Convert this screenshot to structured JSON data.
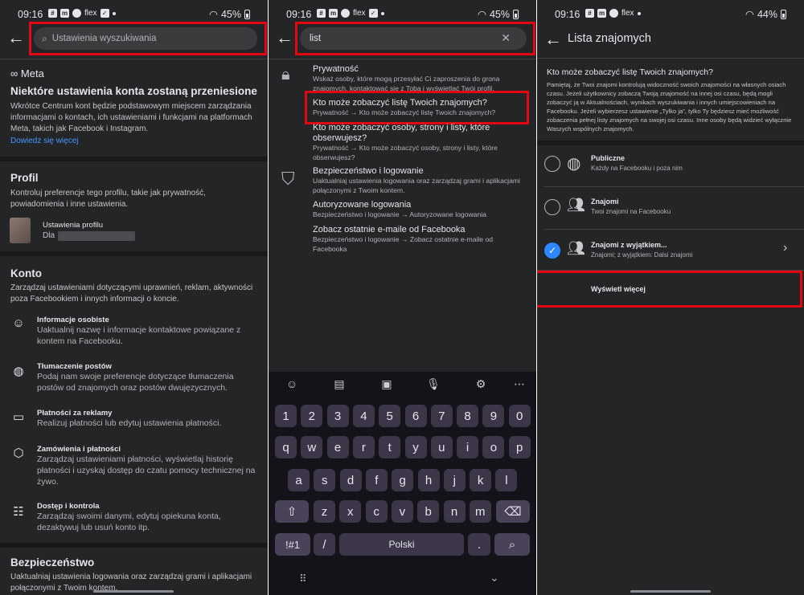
{
  "status": {
    "p1": {
      "time": "09:16",
      "battery": "45%",
      "icons_text": "flex"
    },
    "p2": {
      "time": "09:16",
      "battery": "45%",
      "icons_text": "flex"
    },
    "p3": {
      "time": "09:16",
      "battery": "44%",
      "icons_text": "flex"
    }
  },
  "panel1": {
    "search_placeholder": "Ustawienia wyszukiwania",
    "meta_logo": "Meta",
    "notice": {
      "title": "Niektóre ustawienia konta zostaną przeniesione",
      "body": "Wkrótce Centrum kont będzie podstawowym miejscem zarządzania informacjami o kontach, ich ustawieniami i funkcjami na platformach Meta, takich jak Facebook i Instagram.",
      "link": "Dowiedz się więcej"
    },
    "profile": {
      "title": "Profil",
      "body": "Kontroluj preferencje tego profilu, takie jak prywatność, powiadomienia i inne ustawienia.",
      "item_title": "Ustawienia profilu",
      "item_sub": "Dla"
    },
    "account": {
      "title": "Konto",
      "body": "Zarządzaj ustawieniami dotyczącymi uprawnień, reklam, aktywności poza Facebookiem i innych informacji o koncie.",
      "items": [
        {
          "title": "Informacje osobiste",
          "desc": "Uaktualnij nazwę i informacje kontaktowe powiązane z kontem na Facebooku."
        },
        {
          "title": "Tłumaczenie postów",
          "desc": "Podaj nam swoje preferencje dotyczące tłumaczenia postów od znajomych oraz postów dwujęzycznych."
        },
        {
          "title": "Płatności za reklamy",
          "desc": "Realizuj płatności lub edytuj ustawienia płatności."
        },
        {
          "title": "Zamówienia i płatności",
          "desc": "Zarządzaj ustawieniami płatności, wyświetlaj historię płatności i uzyskaj dostęp do czatu pomocy technicznej na żywo."
        },
        {
          "title": "Dostęp i kontrola",
          "desc": "Zarządzaj swoimi danymi, edytuj opiekuna konta, dezaktywuj lub usuń konto itp."
        }
      ]
    },
    "security": {
      "title": "Bezpieczeństwo",
      "body": "Uaktualniaj ustawienia logowania oraz zarządzaj grami i aplikacjami połączonymi z Twoim kontem."
    }
  },
  "panel2": {
    "search_value": "list",
    "results": [
      {
        "title": "Prywatność",
        "desc": "Wskaż osoby, które mogą przesyłać Ci zaproszenia do grona znajomych, kontaktować się z Tobą i wyświetlać Twój profil."
      },
      {
        "title": "Kto może zobaczyć listę Twoich znajomych?",
        "desc": "Prywatność → Kto może zobaczyć listę Twoich znajomych?"
      },
      {
        "title": "Kto może zobaczyć osoby, strony i listy, które obserwujesz?",
        "desc": "Prywatność → Kto może zobaczyć osoby, strony i listy, które obserwujesz?"
      },
      {
        "title": "Bezpieczeństwo i logowanie",
        "desc": "Uaktualniaj ustawienia logowania oraz zarządzaj grami i aplikacjami połączonymi z Twoim kontem."
      },
      {
        "title": "Autoryzowane logowania",
        "desc": "Bezpieczeństwo i logowanie → Autoryzowane logowania"
      },
      {
        "title": "Zobacz ostatnie e-maile od Facebooka",
        "desc": "Bezpieczeństwo i logowanie → Zobacz ostatnie e-maile od Facebooka"
      }
    ],
    "keyboard": {
      "row0": [
        "1",
        "2",
        "3",
        "4",
        "5",
        "6",
        "7",
        "8",
        "9",
        "0"
      ],
      "row1": [
        "q",
        "w",
        "e",
        "r",
        "t",
        "y",
        "u",
        "i",
        "o",
        "p"
      ],
      "row2": [
        "a",
        "s",
        "d",
        "f",
        "g",
        "h",
        "j",
        "k",
        "l"
      ],
      "row3": [
        "z",
        "x",
        "c",
        "v",
        "b",
        "n",
        "m"
      ],
      "sym": "!#1",
      "slash": "/",
      "space": "Polski",
      "period": "."
    }
  },
  "panel3": {
    "title": "Lista znajomych",
    "question": "Kto może zobaczyć listę Twoich znajomych?",
    "desc": "Pamiętaj, że Twoi znajomi kontrolują widoczność swoich znajomości na własnych osiach czasu. Jeżeli użytkownicy zobaczą Twoją znajomość na innej osi czasu, będą mogli zobaczyć ją w Aktualnościach, wynikach wyszukiwania i innych umiejscowieniach na Facebooku. Jeżeli wybierzesz ustawienie „Tylko ja”, tylko Ty będziesz mieć możliwość zobaczenia pełnej listy znajomych na swojej osi czasu. Inne osoby będą widzieć wyłącznie Waszych wspólnych znajomych.",
    "options": [
      {
        "title": "Publiczne",
        "sub": "Każdy na Facebooku i poza nim"
      },
      {
        "title": "Znajomi",
        "sub": "Twoi znajomi na Facebooku"
      },
      {
        "title": "Znajomi z wyjątkiem...",
        "sub": "Znajomi; z wyjątkiem: Dalsi znajomi"
      }
    ],
    "show_more": "Wyświetl więcej"
  },
  "colors": {
    "background": "#242526",
    "accent": "#2d88ff",
    "highlight": "#e30613",
    "keyboard": "#15131a"
  }
}
